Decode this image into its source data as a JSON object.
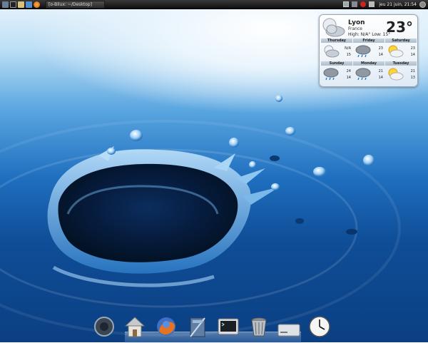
{
  "top_panel": {
    "launchers": [
      "window-icon",
      "terminal-icon",
      "folder-icon",
      "network-icon",
      "firefox-icon"
    ],
    "task_title": "[o-Bilux: ~/Desktop]",
    "tray_icons": [
      "monitor-icon",
      "network-icon",
      "update-icon",
      "volume-icon"
    ],
    "clock": "jeu 21 juin, 21:54"
  },
  "weather": {
    "city": "Lyon",
    "country": "France",
    "temperature": "23°",
    "high_low": "High: N/A°   Low: 15°",
    "days": [
      {
        "name": "Thursday",
        "hi": "N/A",
        "lo": "15",
        "icon": "partly-cloudy-night-icon"
      },
      {
        "name": "Friday",
        "hi": "23",
        "lo": "14",
        "icon": "rain-icon"
      },
      {
        "name": "Saturday",
        "hi": "23",
        "lo": "14",
        "icon": "partly-sunny-icon"
      },
      {
        "name": "Sunday",
        "hi": "24",
        "lo": "14",
        "icon": "rain-icon"
      },
      {
        "name": "Monday",
        "hi": "21",
        "lo": "14",
        "icon": "rain-icon"
      },
      {
        "name": "Tuesday",
        "hi": "21",
        "lo": "13",
        "icon": "partly-sunny-icon"
      }
    ]
  },
  "dock": {
    "items": [
      "speaker-icon",
      "home-folder-icon",
      "firefox-icon",
      "documents-icon",
      "terminal-icon",
      "trash-icon",
      "drive-icon",
      "clock-icon"
    ]
  }
}
